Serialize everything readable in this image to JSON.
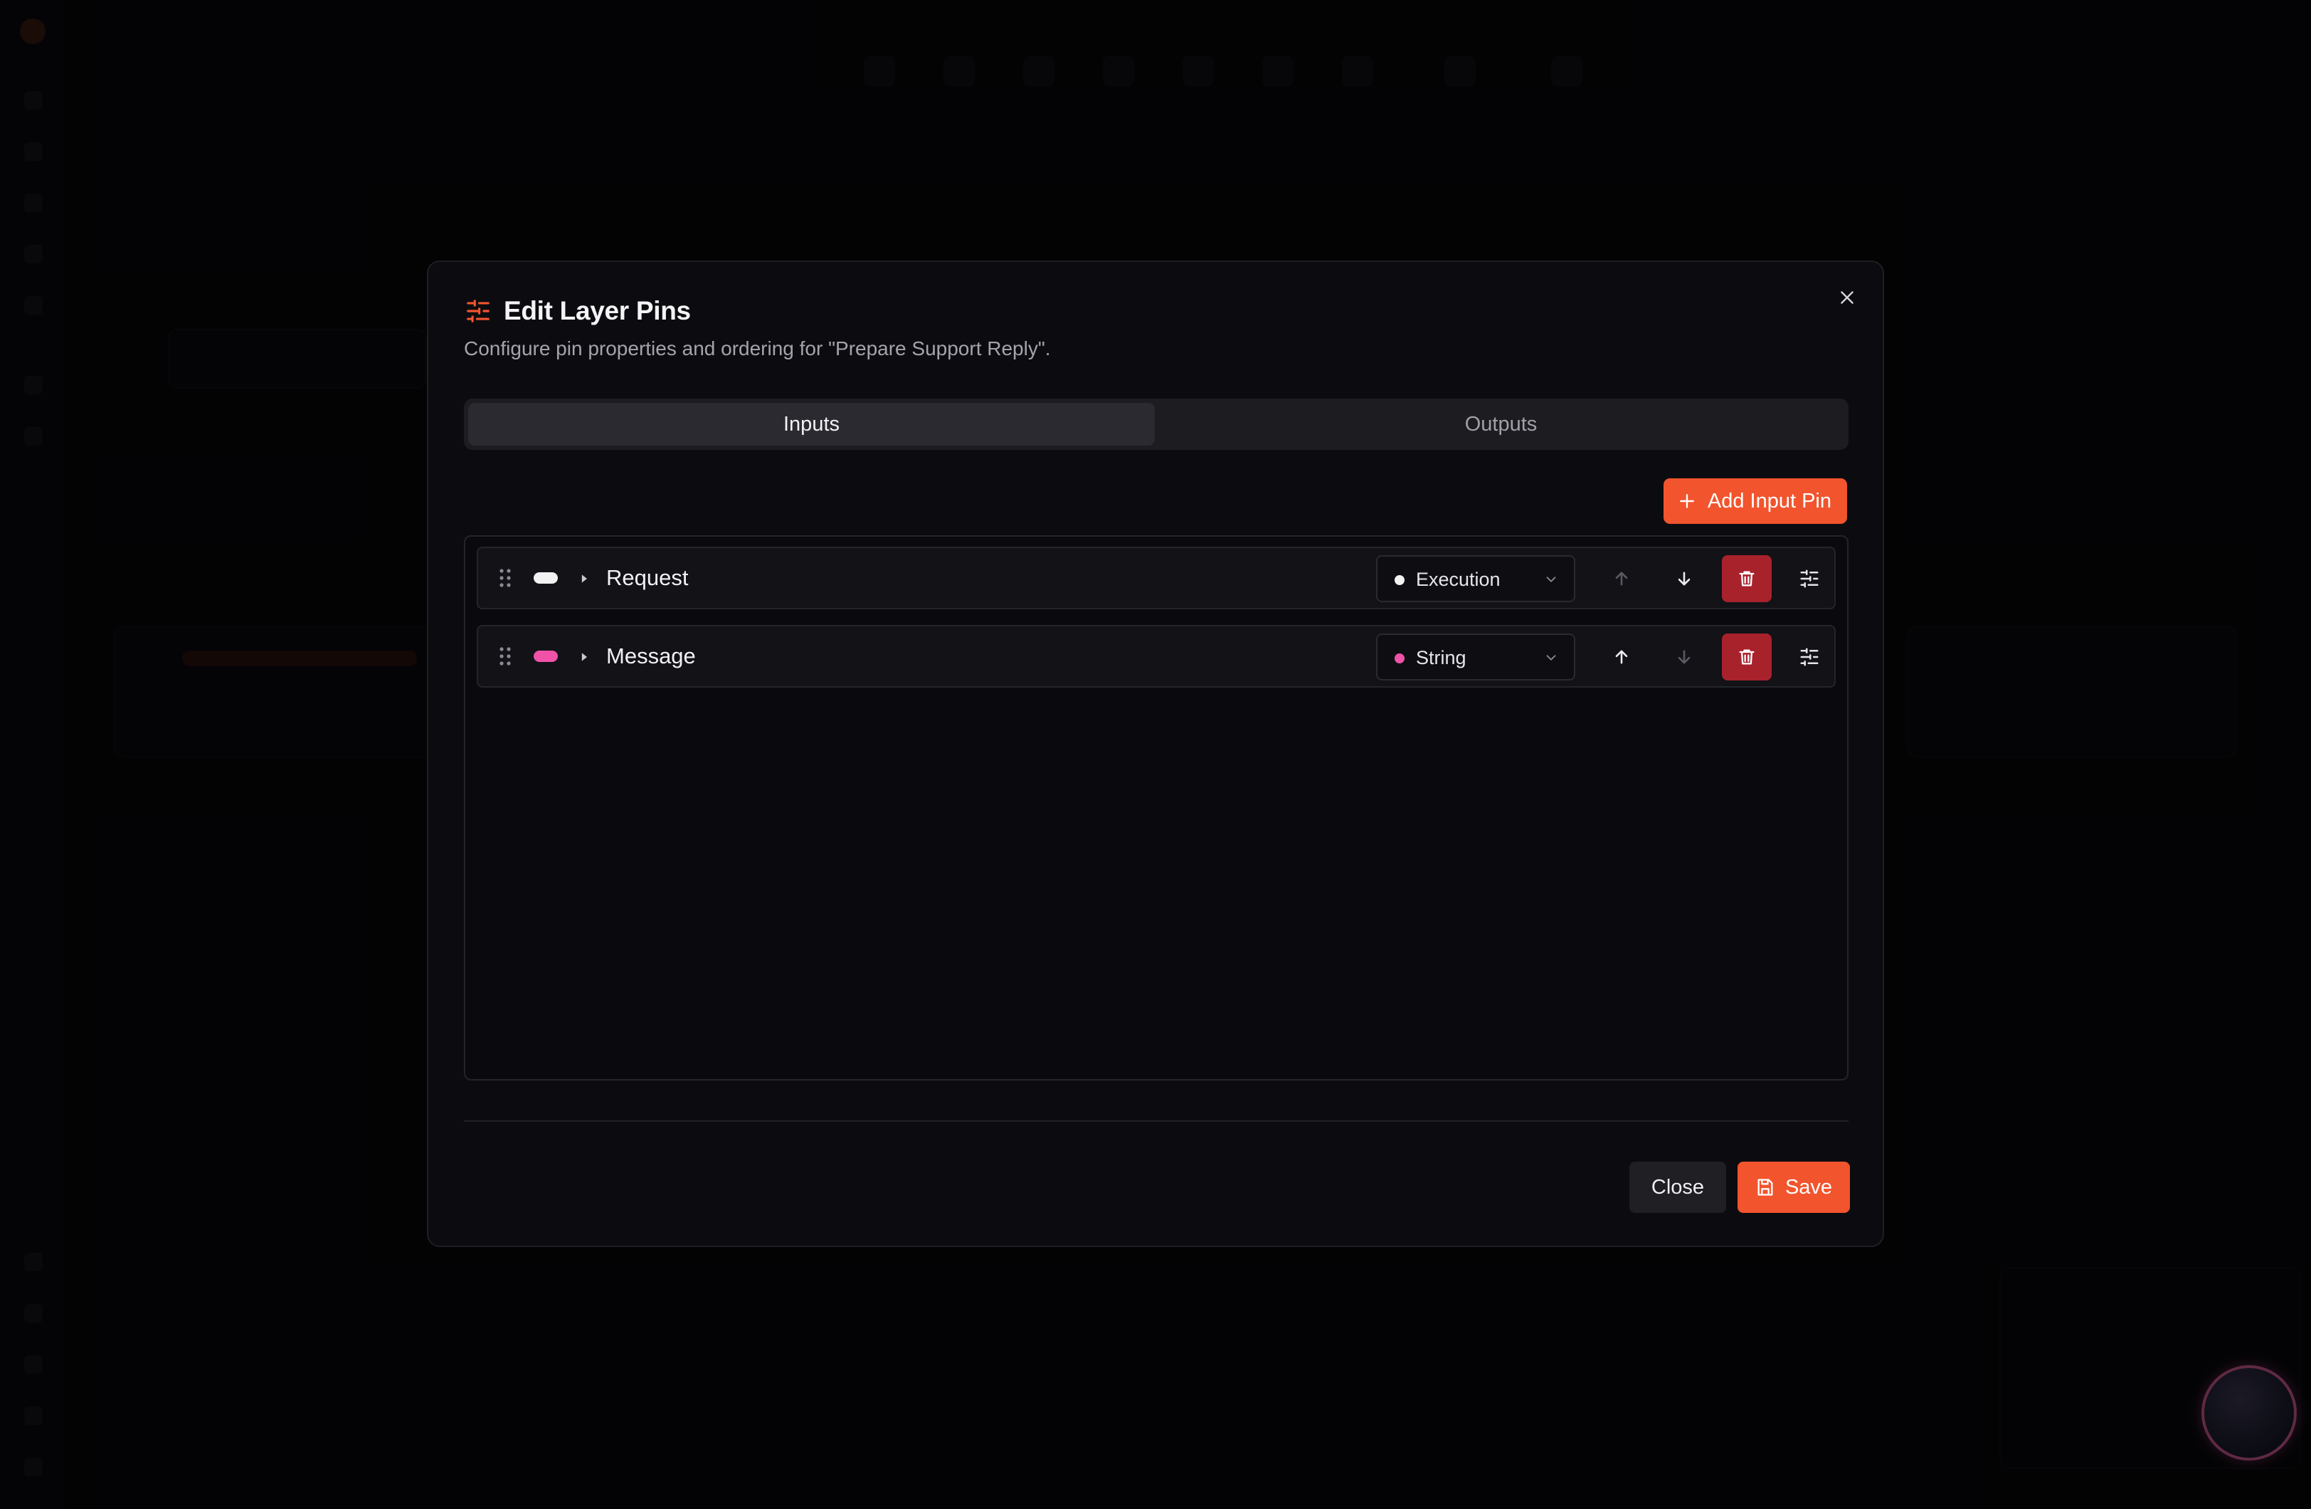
{
  "dialog": {
    "title": "Edit Layer Pins",
    "subtitle": "Configure pin properties and ordering for \"Prepare Support Reply\".",
    "title_icon": "sliders-icon",
    "close_icon": "close-icon"
  },
  "tabs": [
    {
      "label": "Inputs",
      "active": true
    },
    {
      "label": "Outputs",
      "active": false
    }
  ],
  "add_pin_button": {
    "label": "Add Input Pin",
    "icon": "plus-icon"
  },
  "pins": [
    {
      "name": "Request",
      "type": "Execution",
      "color": "#f2f2f2",
      "move_up_enabled": false,
      "move_down_enabled": true
    },
    {
      "name": "Message",
      "type": "String",
      "color": "#f052a8",
      "move_up_enabled": true,
      "move_down_enabled": false
    }
  ],
  "footer": {
    "close_label": "Close",
    "save_label": "Save",
    "save_icon": "save-icon"
  },
  "colors": {
    "accent": "#f2542d",
    "danger": "#a8222c",
    "dialog_bg": "#0c0c10"
  }
}
